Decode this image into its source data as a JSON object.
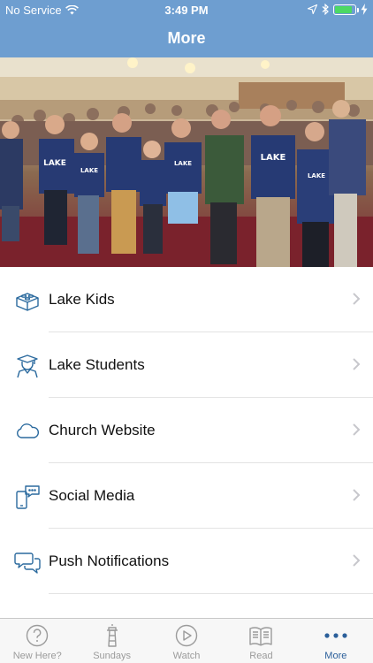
{
  "status_bar": {
    "carrier": "No Service",
    "time": "3:49 PM",
    "battery_level": 0.85,
    "battery_color": "#4cd964"
  },
  "header": {
    "title": "More",
    "background_color": "#6e9ed0"
  },
  "hero": {
    "image": "congregation-photo"
  },
  "menu": {
    "items": [
      {
        "label": "Lake Kids",
        "icon": "lego-brick-icon"
      },
      {
        "label": "Lake Students",
        "icon": "graduate-icon"
      },
      {
        "label": "Church Website",
        "icon": "cloud-icon"
      },
      {
        "label": "Social Media",
        "icon": "phone-chat-icon"
      },
      {
        "label": "Push Notifications",
        "icon": "chat-bubbles-icon"
      }
    ],
    "accent_color": "#2b6a9e"
  },
  "tabbar": {
    "tabs": [
      {
        "label": "New Here?",
        "icon": "question-icon"
      },
      {
        "label": "Sundays",
        "icon": "lighthouse-icon"
      },
      {
        "label": "Watch",
        "icon": "play-icon"
      },
      {
        "label": "Read",
        "icon": "book-icon"
      },
      {
        "label": "More",
        "icon": "more-dots-icon",
        "active": true
      }
    ],
    "active_color": "#2b5f9a",
    "inactive_color": "#9b9b9b"
  }
}
